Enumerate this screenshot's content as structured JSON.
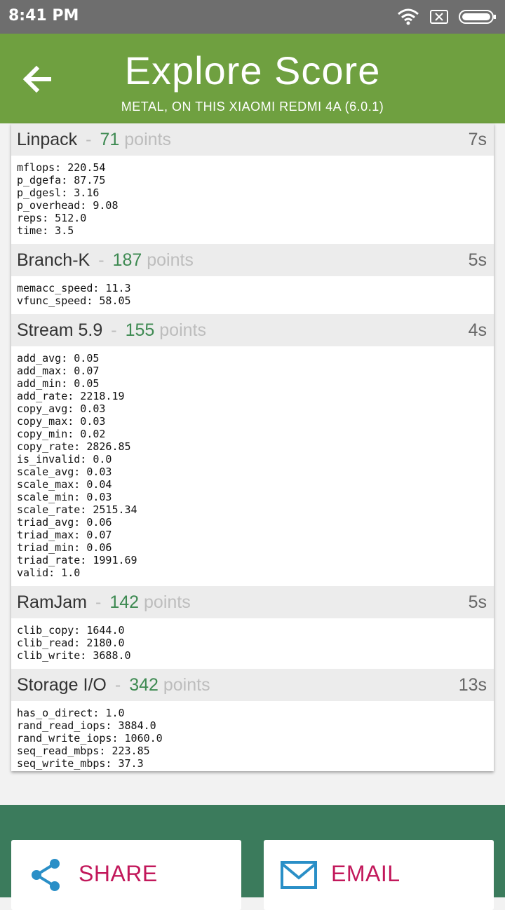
{
  "status_bar": {
    "time": "8:41 PM"
  },
  "header": {
    "title": "Explore Score",
    "subtitle": "METAL, ON THIS XIAOMI REDMI 4A (6.0.1)"
  },
  "points_label": "points",
  "separator": "-",
  "sections": [
    {
      "name": "Linpack",
      "score": "71",
      "time": "7s",
      "metrics": [
        "mflops: 220.54",
        "p_dgefa: 87.75",
        "p_dgesl: 3.16",
        "p_overhead: 9.08",
        "reps: 512.0",
        "time: 3.5"
      ]
    },
    {
      "name": "Branch-K",
      "score": "187",
      "time": "5s",
      "metrics": [
        "memacc_speed: 11.3",
        "vfunc_speed: 58.05"
      ]
    },
    {
      "name": "Stream 5.9",
      "score": "155",
      "time": "4s",
      "metrics": [
        "add_avg: 0.05",
        "add_max: 0.07",
        "add_min: 0.05",
        "add_rate: 2218.19",
        "copy_avg: 0.03",
        "copy_max: 0.03",
        "copy_min: 0.02",
        "copy_rate: 2826.85",
        "is_invalid: 0.0",
        "scale_avg: 0.03",
        "scale_max: 0.04",
        "scale_min: 0.03",
        "scale_rate: 2515.34",
        "triad_avg: 0.06",
        "triad_max: 0.07",
        "triad_min: 0.06",
        "triad_rate: 1991.69",
        "valid: 1.0"
      ]
    },
    {
      "name": "RamJam",
      "score": "142",
      "time": "5s",
      "metrics": [
        "clib_copy: 1644.0",
        "clib_read: 2180.0",
        "clib_write: 3688.0"
      ]
    },
    {
      "name": "Storage I/O",
      "score": "342",
      "time": "13s",
      "metrics": [
        "has_o_direct: 1.0",
        "rand_read_iops: 3884.0",
        "rand_write_iops: 1060.0",
        "seq_read_mbps: 223.85",
        "seq_write_mbps: 37.3"
      ]
    }
  ],
  "actions": {
    "share_label": "SHARE",
    "email_label": "EMAIL"
  },
  "colors": {
    "app_bar": "#6fa040",
    "bottom_bar": "#3b7b5c",
    "score": "#3e8a52",
    "action_label": "#c2185b",
    "action_icon": "#2a8fc7"
  }
}
